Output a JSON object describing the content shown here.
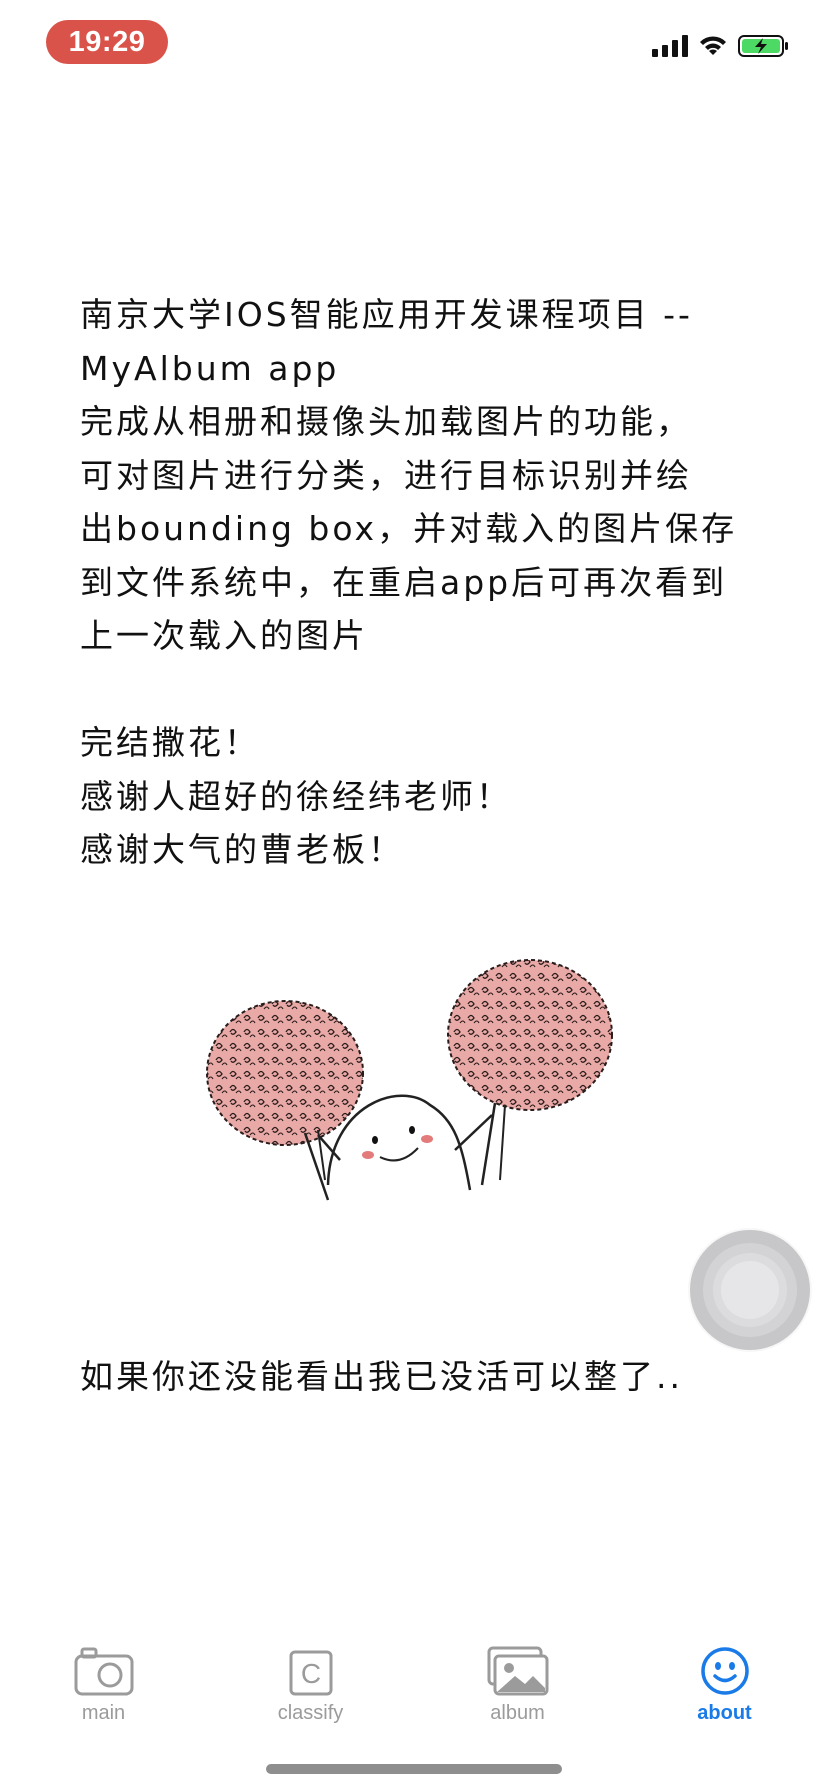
{
  "status_bar": {
    "time": "19:29"
  },
  "content": {
    "lines": [
      "南京大学IOS智能应用开发课程项目 --",
      " MyAlbum app",
      "完成从相册和摄像头加载图片的功能，",
      "可对图片进行分类，进行目标识别并绘",
      "出bounding box，并对载入的图片保存",
      "到文件系统中，在重启app后可再次看到",
      "上一次载入的图片"
    ],
    "thanks": [
      "完结撒花！",
      "感谢人超好的徐经纬老师！",
      "感谢大气的曹老板！"
    ],
    "footer_text": "如果你还没能看出我已没活可以整了.."
  },
  "tabbar": {
    "tabs": [
      {
        "label": "main",
        "icon": "camera-icon",
        "active": false
      },
      {
        "label": "classify",
        "icon": "c-square-icon",
        "active": false
      },
      {
        "label": "album",
        "icon": "photos-icon",
        "active": false
      },
      {
        "label": "about",
        "icon": "smiley-icon",
        "active": true
      }
    ]
  },
  "colors": {
    "time_pill": "#d9534a",
    "tab_active": "#1a7be8",
    "tab_inactive": "#9b9b9b",
    "battery": "#4cd964"
  }
}
